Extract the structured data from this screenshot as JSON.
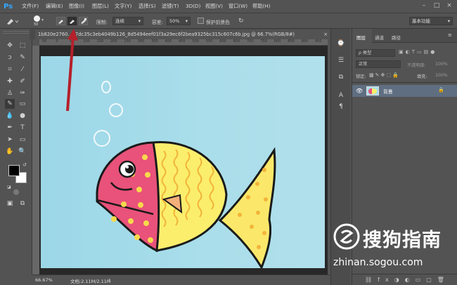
{
  "app": {
    "logo": "Ps"
  },
  "menu": {
    "items": [
      "文件(F)",
      "编辑(E)",
      "图像(I)",
      "图层(L)",
      "文字(Y)",
      "选择(S)",
      "滤镜(T)",
      "3D(D)",
      "视图(V)",
      "窗口(W)",
      "帮助(H)"
    ]
  },
  "options": {
    "brush_size": "50",
    "limit_label": "限制:",
    "limit_value": "连续",
    "tolerance_label": "容差:",
    "tolerance_value": "50%",
    "protect_fg_label": "保护前景色",
    "workspace": "基本功能"
  },
  "document": {
    "tab_title": "1b820e2760...b7dc35c3eb4049b126_8d5494eef01f3a29ec6f2bea9325bc315c607c6b.jpg @ 66.7%(RGB/8#)",
    "tab_close": "×"
  },
  "ruler": {
    "ticks": [
      "50",
      "0",
      "50",
      "100",
      "150",
      "200",
      "250",
      "300",
      "350",
      "400",
      "450",
      "500",
      "550",
      "600",
      "650",
      "700",
      "750",
      "800",
      "850",
      "900",
      "950"
    ]
  },
  "status": {
    "zoom": "66.67%",
    "doc_info": "文档:2.11M/2.11M"
  },
  "layers_panel": {
    "tabs": [
      "图层",
      "通道",
      "路径"
    ],
    "search_placeholder": "ρ 类型",
    "blend_mode": "正常",
    "opacity_label": "不透明度:",
    "opacity_value": "100%",
    "lock_label": "锁定:",
    "fill_label": "填充:",
    "fill_value": "100%",
    "layer_name": "背景"
  },
  "watermark": {
    "brand": "搜狗指南",
    "url": "zhinan.sogou.com"
  },
  "colors": {
    "background": "#535353",
    "canvas": "#a9deea",
    "fish_head": "#e9527a",
    "fish_body": "#fbee6c",
    "fish_tail": "#fbe86a",
    "arrow": "#b5202a",
    "selected_layer": "#5f6e80"
  }
}
